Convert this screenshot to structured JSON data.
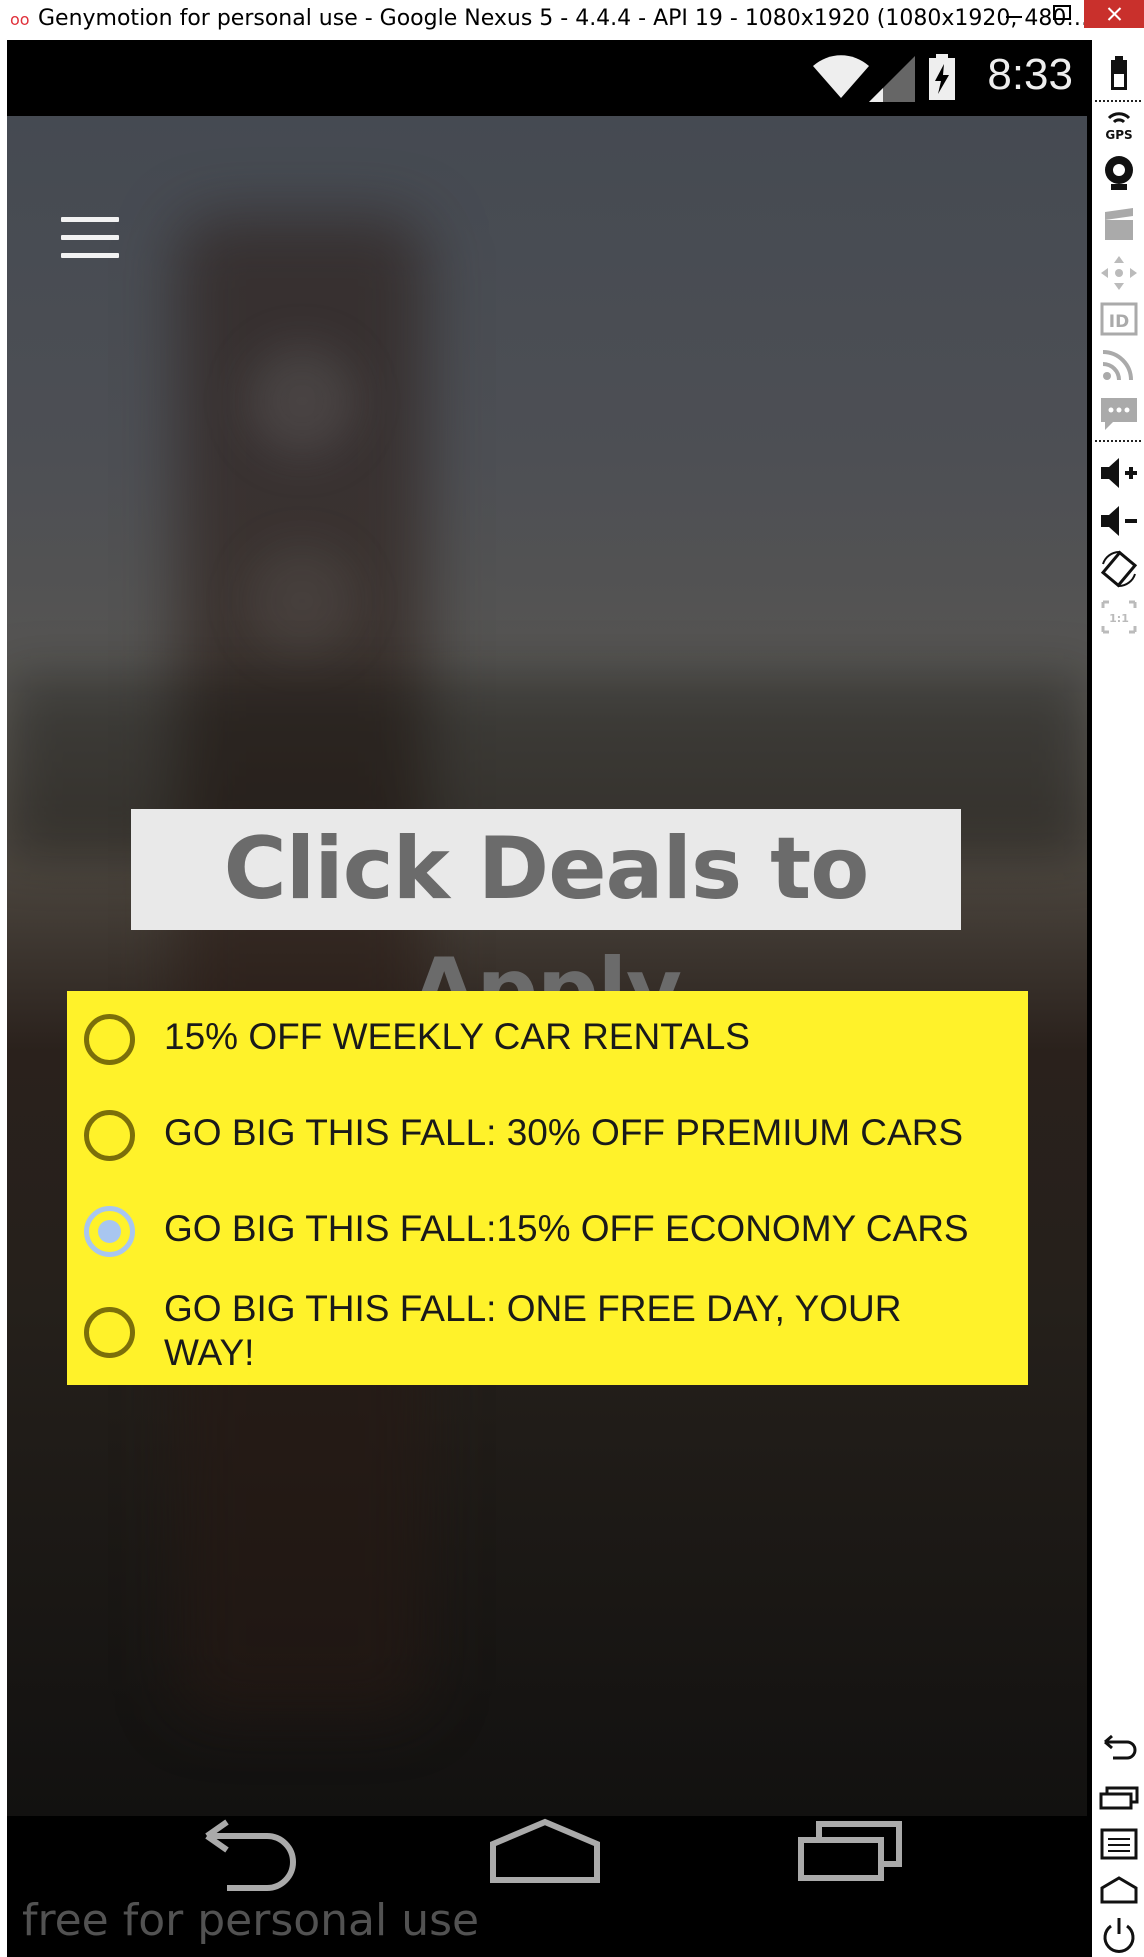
{
  "window": {
    "title": "Genymotion for personal use - Google Nexus 5 - 4.4.4 - API 19 - 1080x1920 (1080x1920, 480…",
    "logo": "oo"
  },
  "status_bar": {
    "time": "8:33",
    "icons": [
      "wifi-icon",
      "signal-icon",
      "battery-charging-icon"
    ]
  },
  "app": {
    "menu_icon": "hamburger-menu-icon",
    "heading": "Click Deals to Apply",
    "deals": [
      {
        "label": "15% OFF WEEKLY CAR RENTALS",
        "checked": false
      },
      {
        "label": "GO BIG THIS FALL: 30% OFF PREMIUM CARS",
        "checked": false
      },
      {
        "label": "GO BIG THIS FALL:15% OFF ECONOMY CARS",
        "checked": true
      },
      {
        "label": "GO BIG THIS FALL: ONE FREE DAY, YOUR",
        "label_line2": "WAY!",
        "checked": false
      }
    ],
    "colors": {
      "deals_background": "#fff22a",
      "heading_background": "#e9e9e9",
      "heading_text": "#6b6b6b",
      "radio_checked": "#a8c6f0"
    }
  },
  "nav_bar": {
    "buttons": [
      "back-icon",
      "home-icon",
      "recent-apps-icon"
    ]
  },
  "watermark": "free for personal use",
  "toolbar": {
    "buttons": [
      "battery-icon",
      "gps-icon",
      "webcam-icon",
      "capture-icon",
      "dpad-icon",
      "id-icon",
      "rss-icon",
      "sms-icon",
      "volume-up-icon",
      "volume-down-icon",
      "rotate-icon",
      "scale-icon",
      "back-icon",
      "recent-apps-icon",
      "menu-icon",
      "home-icon",
      "power-icon"
    ],
    "gps_label": "GPS",
    "id_label": "ID",
    "scale_label": "1:1"
  }
}
